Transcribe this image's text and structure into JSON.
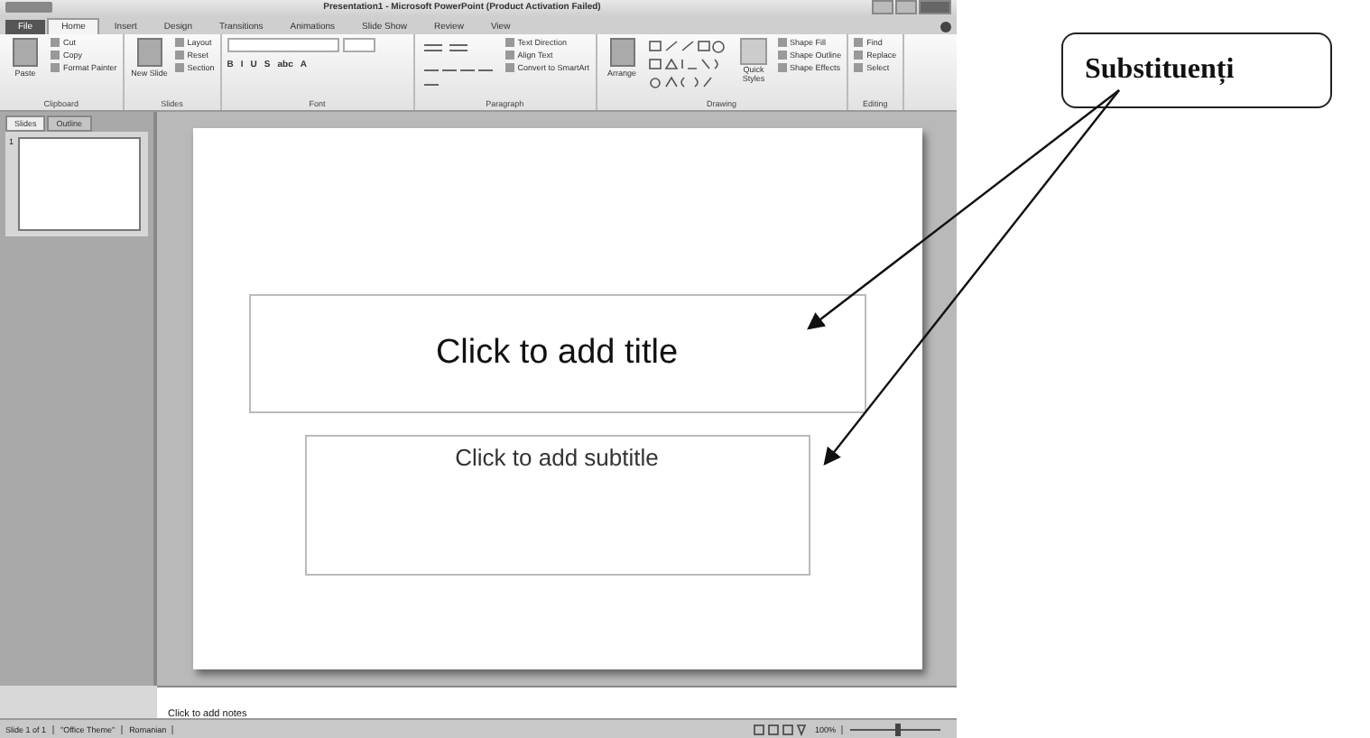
{
  "window": {
    "title": "Presentation1 - Microsoft PowerPoint (Product Activation Failed)"
  },
  "tabs": [
    {
      "label": "File",
      "kind": "file",
      "selected": false
    },
    {
      "label": "Home",
      "kind": "tab",
      "selected": true
    },
    {
      "label": "Insert",
      "kind": "tab",
      "selected": false
    },
    {
      "label": "Design",
      "kind": "tab",
      "selected": false
    },
    {
      "label": "Transitions",
      "kind": "tab",
      "selected": false
    },
    {
      "label": "Animations",
      "kind": "tab",
      "selected": false
    },
    {
      "label": "Slide Show",
      "kind": "tab",
      "selected": false
    },
    {
      "label": "Review",
      "kind": "tab",
      "selected": false
    },
    {
      "label": "View",
      "kind": "tab",
      "selected": false
    }
  ],
  "ribbon": [
    {
      "label": "Clipboard",
      "big": "Paste",
      "items": [
        "Cut",
        "Copy",
        "Format Painter"
      ]
    },
    {
      "label": "Slides",
      "big": "New Slide",
      "items": [
        "Layout",
        "Reset",
        "Section"
      ]
    },
    {
      "label": "Font",
      "kind": "font",
      "items": [
        "B",
        "I",
        "U",
        "S",
        "abc",
        "A"
      ]
    },
    {
      "label": "Paragraph",
      "kind": "paragraph",
      "items": [
        "Text Direction",
        "Align Text",
        "Convert to SmartArt"
      ]
    },
    {
      "label": "Drawing",
      "kind": "drawing",
      "big": "Arrange",
      "items": [
        "Shape Fill",
        "Shape Outline",
        "Shape Effects"
      ],
      "extra": "Quick Styles"
    },
    {
      "label": "Editing",
      "items": [
        "Find",
        "Replace",
        "Select"
      ]
    }
  ],
  "pane_tabs": [
    {
      "label": "Slides",
      "selected": true
    },
    {
      "label": "Outline",
      "selected": false
    }
  ],
  "thumbnail_number": "1",
  "slide": {
    "title_placeholder": "Click to add title",
    "subtitle_placeholder": "Click to add subtitle"
  },
  "notes": {
    "placeholder": "Click to add notes"
  },
  "status_bar": {
    "items": [
      "Slide 1 of 1",
      "\"Office Theme\"",
      "Romanian"
    ],
    "zoom": "100%",
    "level": 0.5
  },
  "callout": {
    "label": "Substituenți"
  }
}
